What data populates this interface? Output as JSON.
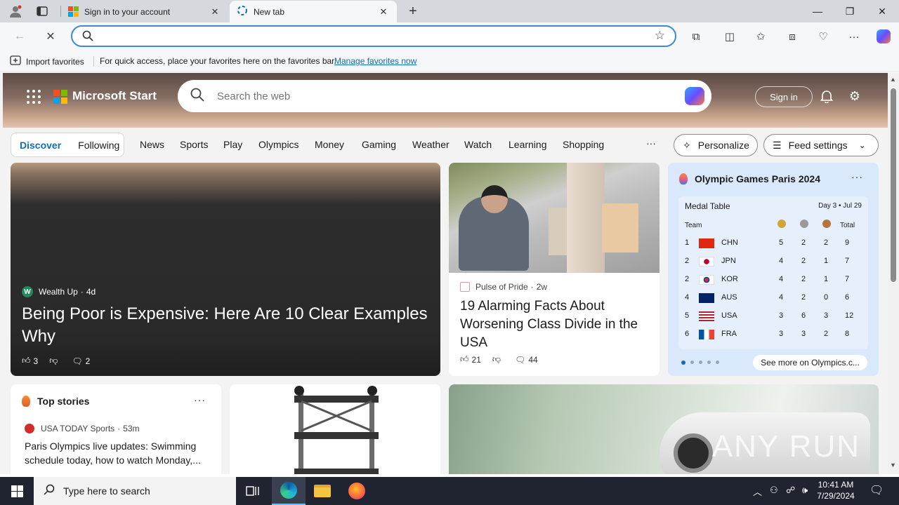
{
  "browser": {
    "tabs": [
      {
        "label": "Sign in to your account",
        "active": false
      },
      {
        "label": "New tab",
        "active": true
      }
    ],
    "address": {
      "value": "",
      "placeholder": ""
    },
    "favorites_bar": {
      "import_label": "Import favorites",
      "hint": "For quick access, place your favorites here on the favorites bar.",
      "manage_link": "Manage favorites now"
    }
  },
  "page": {
    "brand": "Microsoft Start",
    "search_placeholder": "Search the web",
    "sign_in": "Sign in",
    "segments": [
      "Discover",
      "Following"
    ],
    "nav": [
      "News",
      "Sports",
      "Play",
      "Olympics",
      "Money",
      "Gaming",
      "Weather",
      "Watch",
      "Learning",
      "Shopping"
    ],
    "nav_more": "···",
    "personalize": "Personalize",
    "feed_settings": "Feed settings",
    "hero": {
      "source": "Wealth Up",
      "source_initial": "W",
      "age": "4d",
      "title": "Being Poor is Expensive: Here Are 10 Clear Examples Why",
      "likes": "3",
      "comments": "2"
    },
    "news": {
      "source": "Pulse of Pride",
      "age": "2w",
      "title": "19 Alarming Facts About Worsening Class Divide in the USA",
      "likes": "21",
      "comments": "44"
    },
    "olympics": {
      "title": "Olympic Games Paris 2024",
      "more": "···",
      "table_title": "Medal Table",
      "day": "Day 3 • Jul 29",
      "col_team": "Team",
      "col_total": "Total",
      "rows": [
        {
          "rank": "1",
          "code": "CHN",
          "gold": "5",
          "silver": "2",
          "bronze": "2",
          "total": "9"
        },
        {
          "rank": "2",
          "code": "JPN",
          "gold": "4",
          "silver": "2",
          "bronze": "1",
          "total": "7"
        },
        {
          "rank": "2",
          "code": "KOR",
          "gold": "4",
          "silver": "2",
          "bronze": "1",
          "total": "7"
        },
        {
          "rank": "4",
          "code": "AUS",
          "gold": "4",
          "silver": "2",
          "bronze": "0",
          "total": "6"
        },
        {
          "rank": "5",
          "code": "USA",
          "gold": "3",
          "silver": "6",
          "bronze": "3",
          "total": "12"
        },
        {
          "rank": "6",
          "code": "FRA",
          "gold": "3",
          "silver": "3",
          "bronze": "2",
          "total": "8"
        }
      ],
      "see_more": "See more on Olympics.c..."
    },
    "top_stories": {
      "title": "Top stories",
      "more": "···",
      "source": "USA TODAY Sports",
      "age": "53m",
      "headline": "Paris Olympics live updates: Swimming schedule today, how to watch Monday,..."
    },
    "watermark": "ANY RUN"
  },
  "taskbar": {
    "search_placeholder": "Type here to search",
    "time": "10:41 AM",
    "date": "7/29/2024"
  },
  "colors": {
    "accent": "#0f6cbd",
    "omnibox_border": "#3e8ad6",
    "taskbar": "#1f2430"
  }
}
